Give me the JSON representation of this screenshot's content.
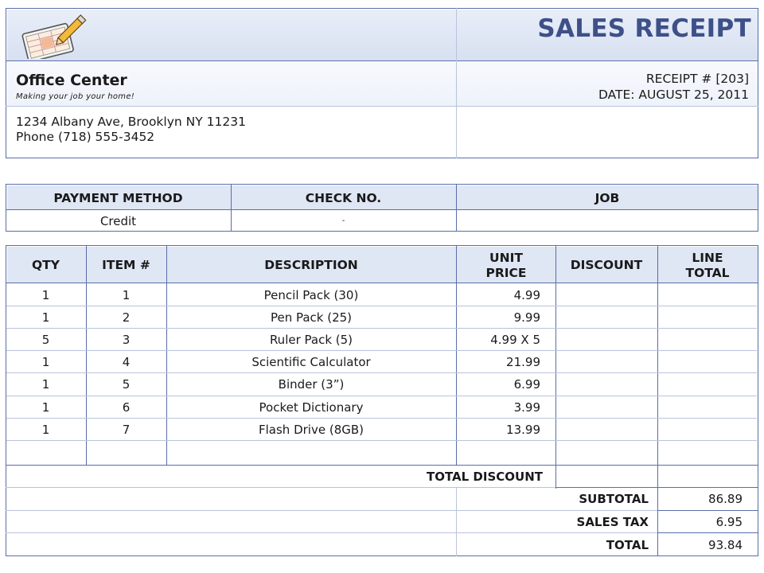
{
  "header": {
    "title": "SALES RECEIPT",
    "company_name": "Office Center",
    "tagline": "Making your job your home!",
    "address": "1234 Albany Ave, Brooklyn NY 11231",
    "phone": "Phone (718) 555-3452",
    "receipt_no": "RECEIPT # [203]",
    "date": "DATE: AUGUST 25, 2011",
    "logo_icon": "receipt-pencil-icon"
  },
  "payment": {
    "headers": [
      "PAYMENT METHOD",
      "CHECK NO.",
      "JOB"
    ],
    "values": [
      "Credit",
      "-",
      ""
    ]
  },
  "items_table": {
    "headers": [
      "QTY",
      "ITEM #",
      "DESCRIPTION",
      "UNIT PRICE",
      "DISCOUNT",
      "LINE TOTAL"
    ],
    "rows": [
      [
        "1",
        "1",
        "Pencil Pack (30)",
        "4.99",
        "",
        ""
      ],
      [
        "1",
        "2",
        "Pen Pack (25)",
        "9.99",
        "",
        ""
      ],
      [
        "5",
        "3",
        "Ruler Pack (5)",
        "4.99 X 5",
        "",
        ""
      ],
      [
        "1",
        "4",
        "Scientific Calculator",
        "21.99",
        "",
        ""
      ],
      [
        "1",
        "5",
        "Binder (3”)",
        "6.99",
        "",
        ""
      ],
      [
        "1",
        "6",
        "Pocket Dictionary",
        "3.99",
        "",
        ""
      ],
      [
        "1",
        "7",
        "Flash Drive (8GB)",
        "13.99",
        "",
        ""
      ],
      [
        "",
        "",
        "",
        "",
        "",
        ""
      ]
    ]
  },
  "totals": {
    "total_discount_label": "TOTAL DISCOUNT",
    "total_discount_value": "",
    "subtotal_label": "SUBTOTAL",
    "subtotal_value": "86.89",
    "sales_tax_label": "SALES TAX",
    "sales_tax_value": "6.95",
    "total_label": "TOTAL",
    "total_value": "93.84"
  },
  "colors": {
    "border": "#5a6ea8",
    "title": "#3d5088",
    "header_fill": "#dfe6f4"
  }
}
